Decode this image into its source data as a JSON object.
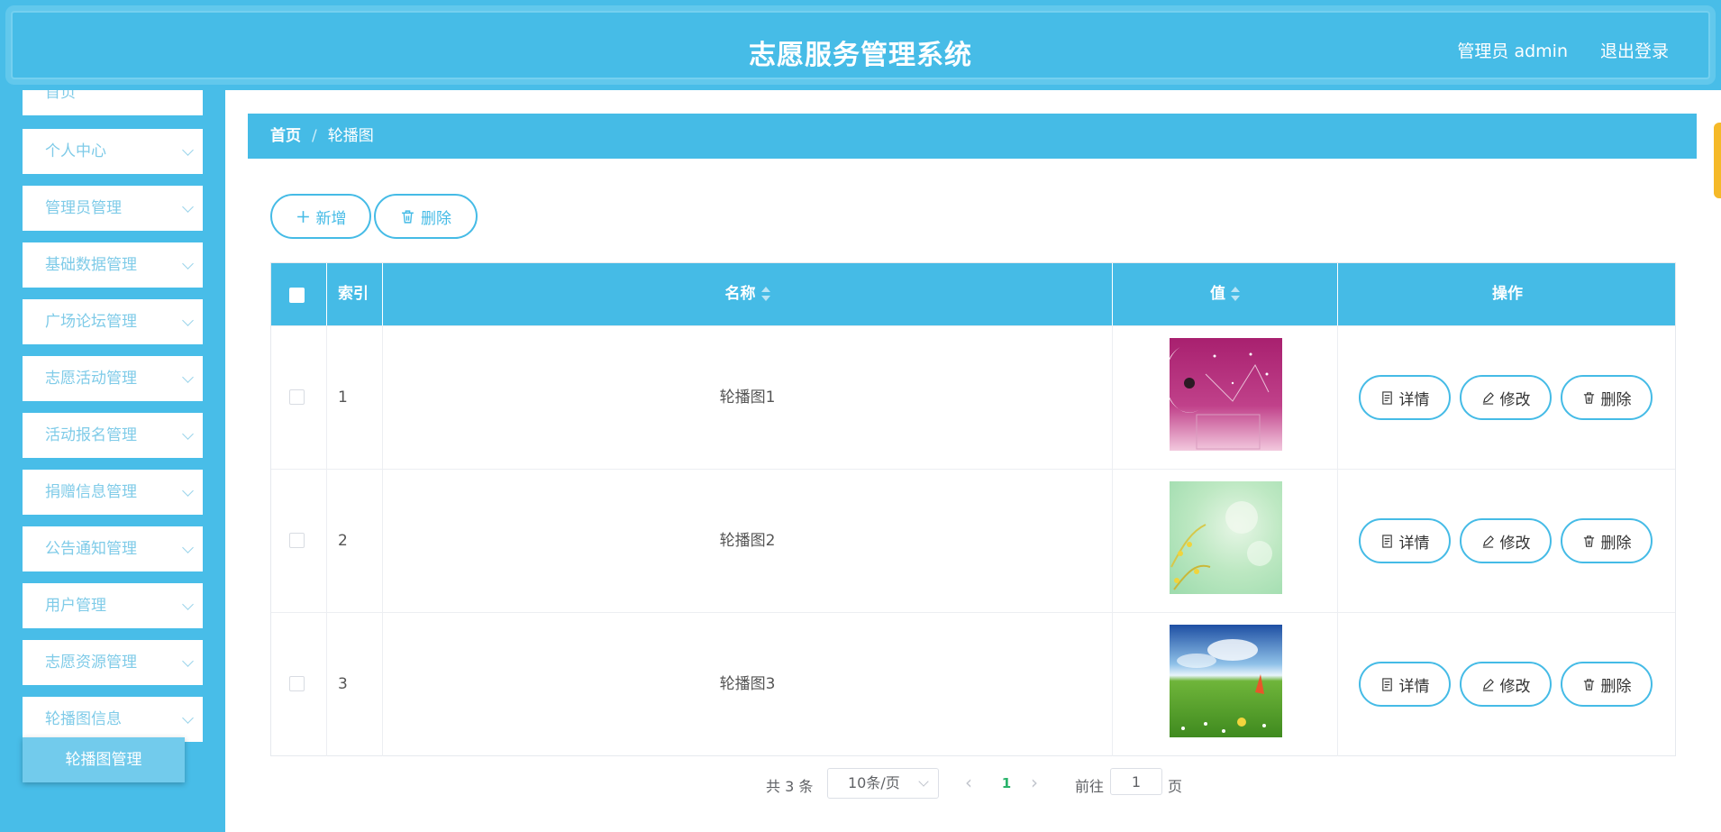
{
  "header": {
    "title": "志愿服务管理系统",
    "user_label": "管理员 admin",
    "logout_label": "退出登录"
  },
  "sidebar": {
    "items": [
      {
        "label": "首页"
      },
      {
        "label": "个人中心"
      },
      {
        "label": "管理员管理"
      },
      {
        "label": "基础数据管理"
      },
      {
        "label": "广场论坛管理"
      },
      {
        "label": "志愿活动管理"
      },
      {
        "label": "活动报名管理"
      },
      {
        "label": "捐赠信息管理"
      },
      {
        "label": "公告通知管理"
      },
      {
        "label": "用户管理"
      },
      {
        "label": "志愿资源管理"
      },
      {
        "label": "轮播图信息"
      }
    ],
    "active_sub": "轮播图管理"
  },
  "breadcrumb": {
    "home": "首页",
    "separator": "/",
    "current": "轮播图"
  },
  "toolbar": {
    "add_label": "新增",
    "delete_label": "删除"
  },
  "table": {
    "headers": {
      "index": "索引",
      "name": "名称",
      "value": "值",
      "actions": "操作"
    },
    "rows": [
      {
        "index": "1",
        "name": "轮播图1",
        "image": "pink-moon-girl"
      },
      {
        "index": "2",
        "name": "轮播图2",
        "image": "green-flowers"
      },
      {
        "index": "3",
        "name": "轮播图3",
        "image": "grass-sky"
      }
    ],
    "actions": {
      "detail": "详情",
      "edit": "修改",
      "delete": "删除"
    }
  },
  "pagination": {
    "total": "共 3 条",
    "page_size": "10条/页",
    "prev": "‹",
    "current_page": "1",
    "next": "›",
    "goto_prefix": "前往",
    "goto_value": "1",
    "goto_suffix": "页"
  },
  "colors": {
    "primary": "#45bbe6",
    "sidebar_text": "#7fcbe8",
    "page_active": "#2ab36b"
  }
}
